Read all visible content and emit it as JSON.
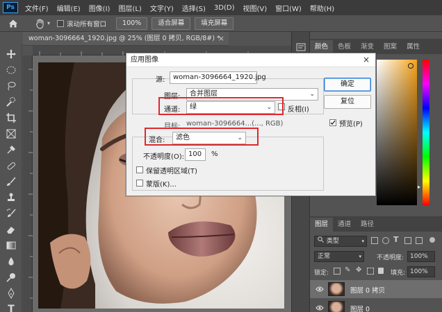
{
  "menubar": {
    "logo": "Ps",
    "items": [
      "文件(F)",
      "编辑(E)",
      "图像(I)",
      "图层(L)",
      "文字(Y)",
      "选择(S)",
      "3D(D)",
      "视图(V)",
      "窗口(W)",
      "帮助(H)"
    ]
  },
  "options": {
    "scroll_all_label": "滚动所有窗口",
    "zoom_100": "100%",
    "fit_screen": "适合屏幕",
    "fill_screen": "填充屏幕"
  },
  "document": {
    "tab_title": "woman-3096664_1920.jpg @ 25% (图层 0 拷贝, RGB/8#) *",
    "close": "×"
  },
  "color_panel": {
    "tabs": [
      "颜色",
      "色板",
      "渐变",
      "图案",
      "属性"
    ]
  },
  "layers_panel": {
    "tabs": [
      "图层",
      "通道",
      "路径"
    ],
    "kind_label": "类型",
    "blend_mode": "正常",
    "opacity_label": "不透明度:",
    "opacity_value": "100%",
    "lock_label": "锁定:",
    "fill_label": "填充:",
    "fill_value": "100%",
    "layers": [
      {
        "name": "图层 0 拷贝",
        "selected": true
      },
      {
        "name": "图层 0",
        "selected": false
      }
    ]
  },
  "dialog": {
    "title": "应用图像",
    "close": "×",
    "source_label": "源:",
    "source_value": "woman-3096664_1920.jpg",
    "layer_label": "图层:",
    "layer_value": "合并图层",
    "channel_label": "通道:",
    "channel_value": "绿",
    "invert_label": "反相(I)",
    "target_label": "目标:",
    "target_value": "woman-3096664...(..., RGB)",
    "blend_label": "混合:",
    "blend_value": "滤色",
    "opacity_label": "不透明度(O):",
    "opacity_value": "100",
    "opacity_unit": "%",
    "preserve_label": "保留透明区域(T)",
    "mask_label": "蒙版(K)...",
    "ok": "确定",
    "cancel": "复位",
    "preview_label": "预览(P)"
  },
  "colors": {
    "accent": "#31a8ff",
    "highlight_box": "#e0262c",
    "dialog_bg": "#f0f0f0",
    "app_bg": "#535353"
  }
}
